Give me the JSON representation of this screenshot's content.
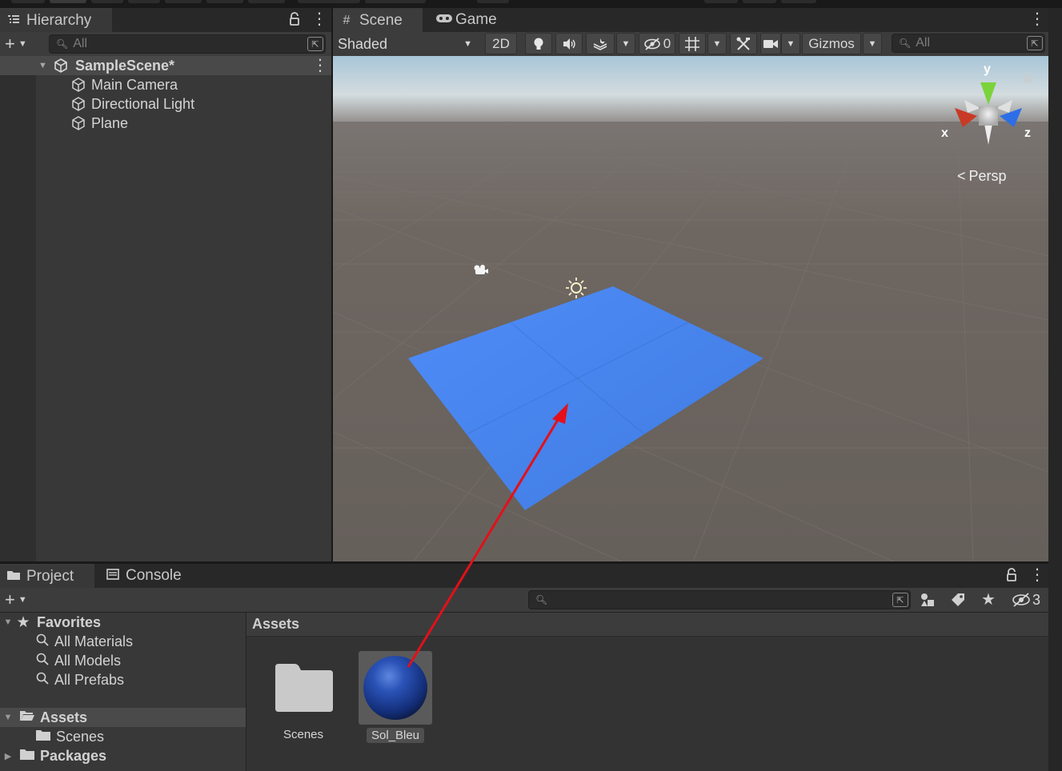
{
  "colors": {
    "background": "#191919",
    "panel": "#383838",
    "tab_bar": "#282828",
    "scene_ground": "#6a625d",
    "plane": "#4a86ef",
    "selection": "#4a4a4a",
    "arrow": "#e3101a"
  },
  "hierarchy": {
    "tab_label": "Hierarchy",
    "search_placeholder": "All",
    "scene_name": "SampleScene*",
    "items": [
      {
        "label": "Main Camera",
        "icon": "cube-icon"
      },
      {
        "label": "Directional Light",
        "icon": "cube-icon"
      },
      {
        "label": "Plane",
        "icon": "cube-icon"
      }
    ]
  },
  "scene": {
    "tab_label": "Scene",
    "game_tab_label": "Game",
    "shading_mode": "Shaded",
    "mode_2d": "2D",
    "hidden_count": "0",
    "gizmos_label": "Gizmos",
    "search_placeholder": "All",
    "projection_label": "Persp",
    "axis_x": "x",
    "axis_y": "y",
    "axis_z": "z"
  },
  "project": {
    "tab_label": "Project",
    "console_tab_label": "Console",
    "hidden_packages_count": "3",
    "breadcrumb": "Assets",
    "favorites_label": "Favorites",
    "favorites": [
      "All Materials",
      "All Models",
      "All Prefabs"
    ],
    "assets_label": "Assets",
    "assets_children": [
      "Scenes"
    ],
    "packages_label": "Packages",
    "grid_items": [
      {
        "label": "Scenes",
        "type": "folder"
      },
      {
        "label": "Sol_Bleu",
        "type": "material",
        "selected": true
      }
    ]
  }
}
